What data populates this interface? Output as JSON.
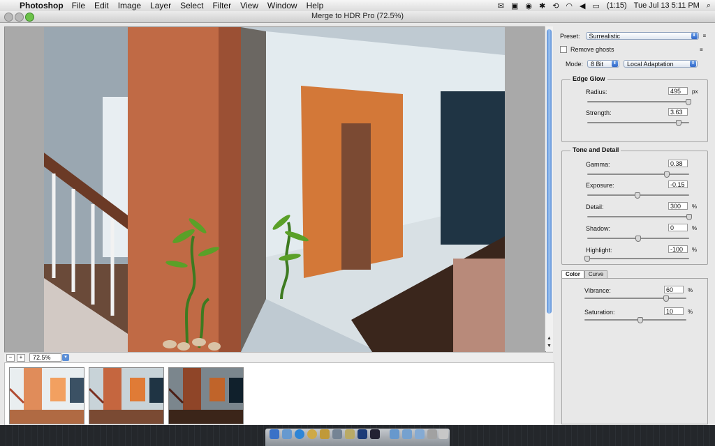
{
  "menubar": {
    "app_name": "Photoshop",
    "menus": [
      "File",
      "Edit",
      "Image",
      "Layer",
      "Select",
      "Filter",
      "View",
      "Window",
      "Help"
    ],
    "battery": "(1:15)",
    "clock": "Tue Jul 13  5:11 PM"
  },
  "window": {
    "title": "Merge to HDR Pro (72.5%)"
  },
  "zoom": {
    "value": "72.5%"
  },
  "panel": {
    "preset_label": "Preset:",
    "preset_value": "Surrealistic",
    "remove_ghosts_label": "Remove ghosts",
    "remove_ghosts_checked": false,
    "mode_label": "Mode:",
    "mode_bits": "8 Bit",
    "mode_method": "Local Adaptation",
    "edge_glow": {
      "title": "Edge Glow",
      "radius": {
        "label": "Radius:",
        "value": "495",
        "unit": "px",
        "level": 0.99
      },
      "strength": {
        "label": "Strength:",
        "value": "3.63",
        "unit": "",
        "level": 0.9
      }
    },
    "tone_detail": {
      "title": "Tone and Detail",
      "gamma": {
        "label": "Gamma:",
        "value": "0.38",
        "unit": "",
        "level": 0.78
      },
      "exposure": {
        "label": "Exposure:",
        "value": "-0.15",
        "unit": "",
        "level": 0.49
      },
      "detail": {
        "label": "Detail:",
        "value": "300",
        "unit": "%",
        "level": 1.0
      },
      "shadow": {
        "label": "Shadow:",
        "value": "0",
        "unit": "%",
        "level": 0.5
      },
      "highlight": {
        "label": "Highlight:",
        "value": "-100",
        "unit": "%",
        "level": 0.0
      }
    },
    "tabs": {
      "color": "Color",
      "curve": "Curve"
    },
    "color": {
      "vibrance": {
        "label": "Vibrance:",
        "value": "60",
        "unit": "%",
        "level": 0.8
      },
      "saturation": {
        "label": "Saturation:",
        "value": "10",
        "unit": "%",
        "level": 0.55
      }
    }
  }
}
